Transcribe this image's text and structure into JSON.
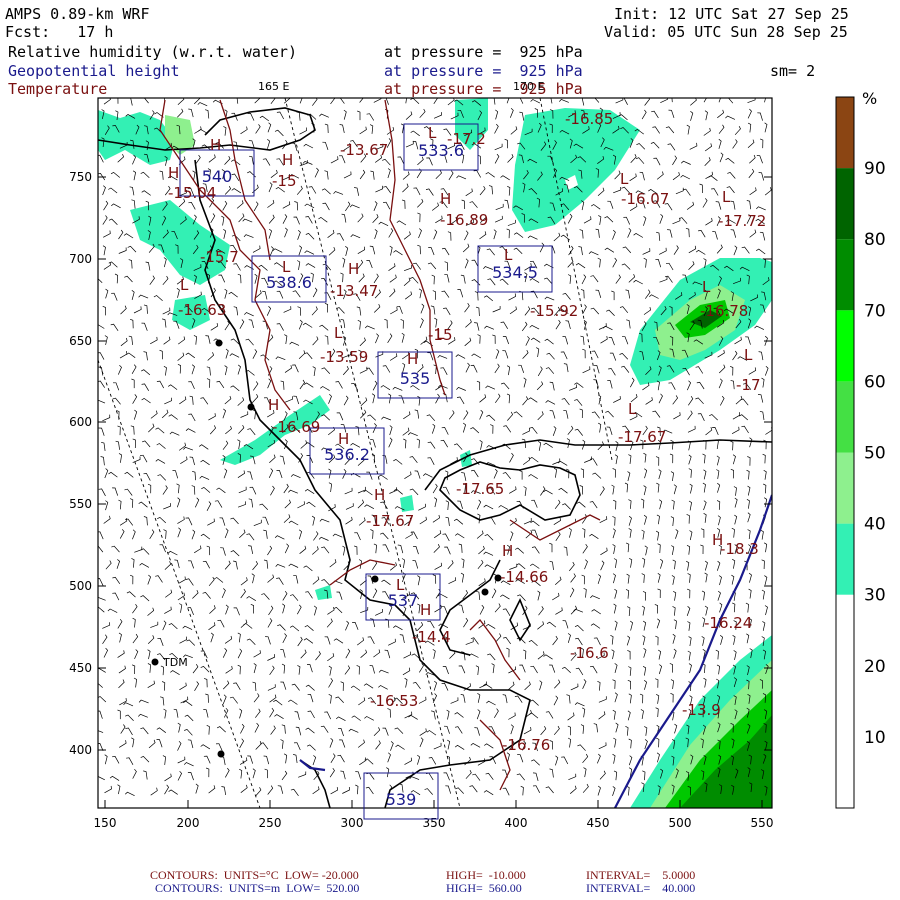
{
  "header": {
    "model": "AMPS 0.89-km WRF",
    "forecast": "Fcst:   17 h",
    "init": "Init: 12 UTC Sat 27 Sep 25",
    "valid": "Valid: 05 UTC Sun 28 Sep 25",
    "field1_name": "Relative humidity (w.r.t. water)",
    "field1_level": "at pressure =  925 hPa",
    "field2_name": "Geopotential height",
    "field2_level": "at pressure =  925 hPa",
    "field3_name": "Temperature",
    "field3_level": "at pressure =  925 hPa",
    "smoothing": "sm= 2"
  },
  "map": {
    "meridian_labels": [
      "165 E",
      "170 E"
    ],
    "x_ticks": [
      "150",
      "200",
      "250",
      "300",
      "350",
      "400",
      "450",
      "500",
      "550"
    ],
    "y_ticks": [
      "750",
      "700",
      "650",
      "600",
      "550",
      "500",
      "450",
      "400"
    ],
    "station": "TDM",
    "colors": {
      "rh_30": "#33f0b4",
      "rh_40": "#8ef08e",
      "rh_60": "#00c800",
      "rh_70": "#008c00",
      "rh_80": "#006400",
      "rh_90": "#8b4513",
      "temp_contour": "#7a1010",
      "height_contour": "#1a1a8c",
      "coast": "#000000"
    },
    "temperature_labels": [
      "-15.04",
      "-15.7",
      "-16.63",
      "-15",
      "-13.67",
      "-17.2",
      "-16.85",
      "-16.07",
      "-17.72",
      "-16.89",
      "-13.47",
      "-15.92",
      "-13.59",
      "-15",
      "-16.78",
      "-17",
      "-16.69",
      "-17.67",
      "-17.65",
      "-17.67",
      "-14.66",
      "-18.3",
      "-16.24",
      "-16.6",
      "-14.4",
      "-16.53",
      "-16.76",
      "-13.9"
    ],
    "height_labels": [
      "540",
      "533.6",
      "538.6",
      "534.5",
      "535",
      "536.2",
      "537",
      "539"
    ],
    "pressure_centers": [
      "H",
      "L",
      "H",
      "H",
      "L",
      "L",
      "H",
      "L",
      "H",
      "L",
      "L",
      "L",
      "L",
      "H",
      "L",
      "L",
      "H",
      "L",
      "H",
      "H",
      "H",
      "L",
      "H",
      "H"
    ]
  },
  "colorbar": {
    "unit": "%",
    "ticks": [
      "90",
      "80",
      "70",
      "60",
      "50",
      "40",
      "30",
      "20",
      "10"
    ],
    "bands": [
      {
        "from": 0,
        "to": 30,
        "color": "#ffffff"
      },
      {
        "from": 30,
        "to": 40,
        "color": "#33f0b4"
      },
      {
        "from": 40,
        "to": 50,
        "color": "#8ef08e"
      },
      {
        "from": 50,
        "to": 60,
        "color": "#44e044"
      },
      {
        "from": 60,
        "to": 70,
        "color": "#00ff00"
      },
      {
        "from": 70,
        "to": 80,
        "color": "#008c00"
      },
      {
        "from": 80,
        "to": 90,
        "color": "#006400"
      },
      {
        "from": 90,
        "to": 100,
        "color": "#8b4513"
      }
    ]
  },
  "footer": {
    "line1_a": "CONTOURS:  UNITS=°C  LOW= -20.000",
    "line1_b": "HIGH=  -10.000",
    "line1_c": "INTERVAL=    5.0000",
    "line2_a": "CONTOURS:  UNITS=m  LOW=  520.00",
    "line2_b": "HIGH=  560.00",
    "line2_c": "INTERVAL=    40.000"
  }
}
